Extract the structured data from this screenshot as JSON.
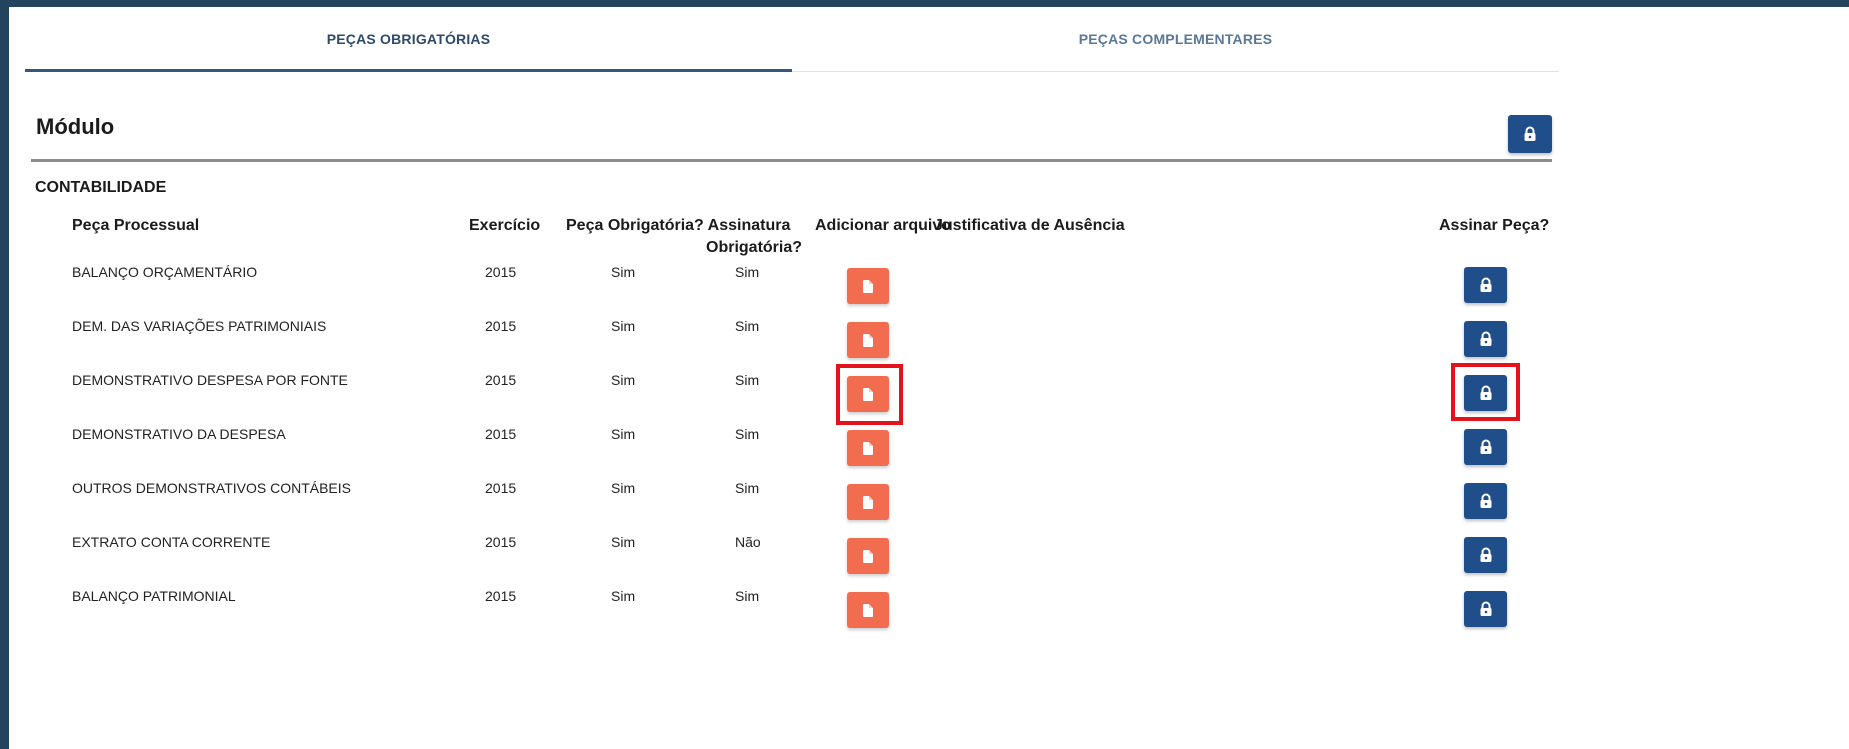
{
  "tabs": [
    {
      "label": "PEÇAS OBRIGATÓRIAS",
      "active": true
    },
    {
      "label": "PEÇAS COMPLEMENTARES",
      "active": false
    }
  ],
  "module_title": "Módulo",
  "section_title": "CONTABILIDADE",
  "columns": {
    "peca": "Peça Processual",
    "exercicio": "Exercício",
    "obrigatoria": "Peça Obrigatória?",
    "assinatura_l1": "Assinatura",
    "assinatura_l2": "Obrigatória?",
    "adicionar": "Adicionar arquivo",
    "justificativa": "Justificativa de Ausência",
    "assinar": "Assinar Peça?"
  },
  "rows": [
    {
      "peca": "BALANÇO ORÇAMENTÁRIO",
      "exercicio": "2015",
      "obrigatoria": "Sim",
      "assinatura": "Sim",
      "highlighted": false
    },
    {
      "peca": "DEM. DAS VARIAÇÕES PATRIMONIAIS",
      "exercicio": "2015",
      "obrigatoria": "Sim",
      "assinatura": "Sim",
      "highlighted": false
    },
    {
      "peca": "DEMONSTRATIVO DESPESA POR FONTE",
      "exercicio": "2015",
      "obrigatoria": "Sim",
      "assinatura": "Sim",
      "highlighted": true
    },
    {
      "peca": "DEMONSTRATIVO DA DESPESA",
      "exercicio": "2015",
      "obrigatoria": "Sim",
      "assinatura": "Sim",
      "highlighted": false
    },
    {
      "peca": "OUTROS DEMONSTRATIVOS CONTÁBEIS",
      "exercicio": "2015",
      "obrigatoria": "Sim",
      "assinatura": "Sim",
      "highlighted": false
    },
    {
      "peca": "EXTRATO CONTA CORRENTE",
      "exercicio": "2015",
      "obrigatoria": "Sim",
      "assinatura": "Não",
      "highlighted": false
    },
    {
      "peca": "BALANÇO PATRIMONIAL",
      "exercicio": "2015",
      "obrigatoria": "Sim",
      "assinatura": "Sim",
      "highlighted": false
    }
  ],
  "icons": {
    "file": "file-icon",
    "lock": "lock-icon"
  },
  "colors": {
    "navy": "#1f4e8a",
    "orange": "#f26c4f",
    "highlight": "#e3121b",
    "frame": "#24435c"
  }
}
